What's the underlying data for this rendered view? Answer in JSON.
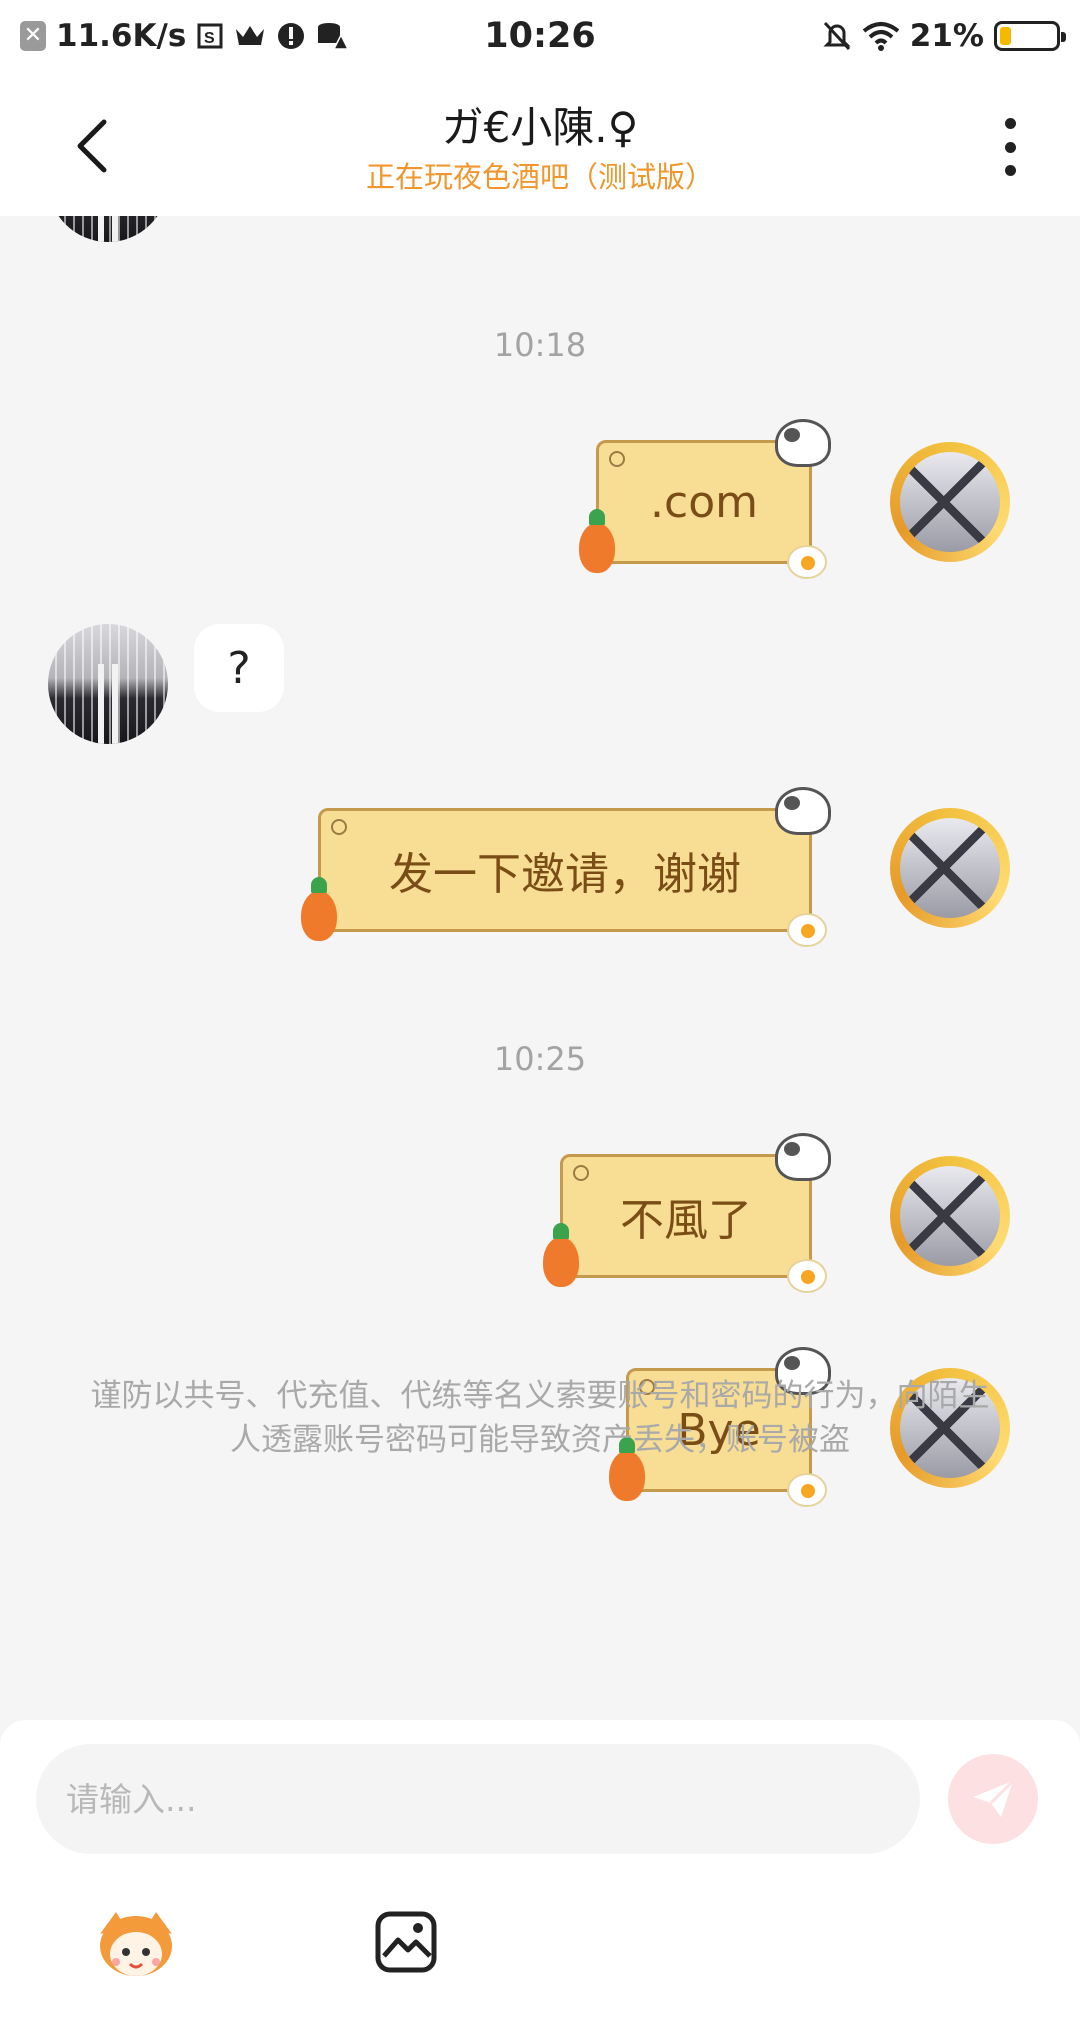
{
  "status_bar": {
    "speed": "11.6K/s",
    "time": "10:26",
    "battery": "21%",
    "battery_level": 0.21
  },
  "header": {
    "title": "ガ€小陳.♀",
    "subtitle": "正在玩夜色酒吧（测试版）"
  },
  "messages": [
    {
      "type": "time",
      "text": "10:18"
    },
    {
      "type": "me",
      "text": ".com"
    },
    {
      "type": "other",
      "text": "?"
    },
    {
      "type": "me",
      "text": "发一下邀请，谢谢"
    },
    {
      "type": "time",
      "text": "10:25"
    },
    {
      "type": "me",
      "text": "不風了"
    },
    {
      "type": "me",
      "text": "Bye"
    }
  ],
  "notice": "谨防以共号、代充值、代练等名义索要账号和密码的行为，向陌生人透露账号密码可能导致资产丢失，账号被盗",
  "input": {
    "placeholder": "请输入..."
  },
  "colors": {
    "accent": "#f0962c",
    "bubble_me": "#f7de94",
    "bubble_me_text": "#7a4d16",
    "send_bg": "#fde1e2"
  }
}
